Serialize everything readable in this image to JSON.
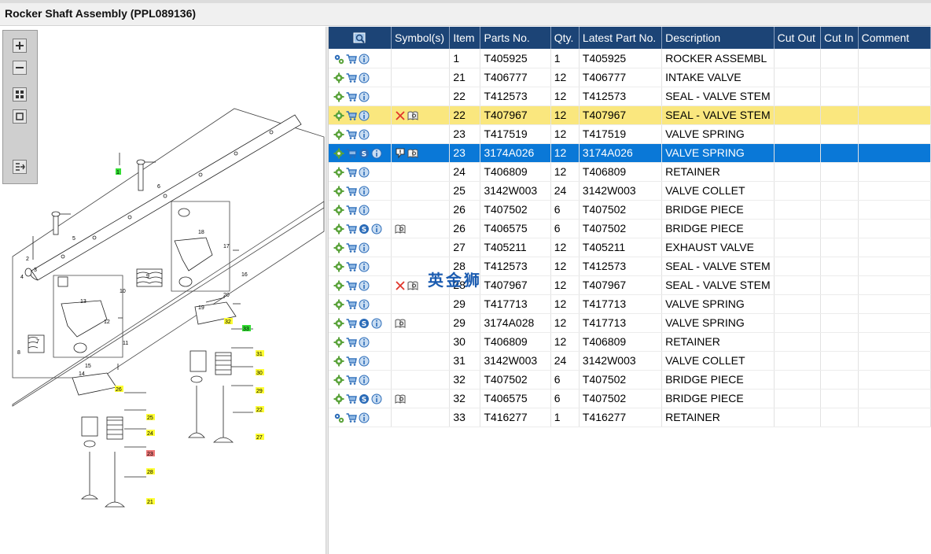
{
  "window": {
    "title": "Rocker Shaft Assembly (PPL089136)"
  },
  "colors": {
    "header_bg": "#1c4476",
    "highlight_yellow": "#fae77e",
    "selected_blue": "#0a78d7",
    "callout_yellow": "#ffff33",
    "callout_green": "#33dd33",
    "callout_red": "#ee7777"
  },
  "toolbar": {
    "buttons": [
      {
        "icon": "zoom-in-icon"
      },
      {
        "icon": "zoom-out-icon"
      },
      {
        "icon": "fit-all-icon"
      },
      {
        "icon": "fit-window-icon"
      },
      {
        "icon": "export-icon"
      }
    ]
  },
  "diagram": {
    "callouts": [
      {
        "label": "1",
        "style": "green"
      },
      {
        "label": "2",
        "style": "plain"
      },
      {
        "label": "3",
        "style": "plain"
      },
      {
        "label": "4",
        "style": "plain"
      },
      {
        "label": "5",
        "style": "plain"
      },
      {
        "label": "6",
        "style": "plain"
      },
      {
        "label": "7",
        "style": "plain"
      },
      {
        "label": "8",
        "style": "plain"
      },
      {
        "label": "9",
        "style": "plain"
      },
      {
        "label": "10",
        "style": "plain"
      },
      {
        "label": "11",
        "style": "plain"
      },
      {
        "label": "12",
        "style": "plain"
      },
      {
        "label": "13",
        "style": "plain"
      },
      {
        "label": "14",
        "style": "plain"
      },
      {
        "label": "15",
        "style": "plain"
      },
      {
        "label": "16",
        "style": "plain"
      },
      {
        "label": "17",
        "style": "plain"
      },
      {
        "label": "18",
        "style": "plain"
      },
      {
        "label": "19",
        "style": "plain"
      },
      {
        "label": "20",
        "style": "plain"
      },
      {
        "label": "21",
        "style": "yellow"
      },
      {
        "label": "22",
        "style": "yellow"
      },
      {
        "label": "23",
        "style": "red"
      },
      {
        "label": "24",
        "style": "yellow"
      },
      {
        "label": "25",
        "style": "yellow"
      },
      {
        "label": "26",
        "style": "yellow"
      },
      {
        "label": "27",
        "style": "yellow"
      },
      {
        "label": "28",
        "style": "yellow"
      },
      {
        "label": "29",
        "style": "yellow"
      },
      {
        "label": "30",
        "style": "yellow"
      },
      {
        "label": "31",
        "style": "yellow"
      },
      {
        "label": "32",
        "style": "yellow"
      },
      {
        "label": "33",
        "style": "green"
      }
    ]
  },
  "table": {
    "columns": [
      "",
      "Symbol(s)",
      "Item",
      "Parts No.",
      "Qty.",
      "Latest Part No.",
      "Description",
      "Cut Out",
      "Cut In",
      "Comment"
    ],
    "rows": [
      {
        "actions": [
          "assembly-gear-icon",
          "cart-icon",
          "info-icon"
        ],
        "symbols": [],
        "item": "1",
        "part": "T405925",
        "qty": "1",
        "latest": "T405925",
        "desc": "ROCKER ASSEMBL",
        "cut_out": "",
        "cut_in": "",
        "comment": "",
        "state": ""
      },
      {
        "actions": [
          "gear-icon",
          "cart-icon",
          "info-icon"
        ],
        "symbols": [],
        "item": "21",
        "part": "T406777",
        "qty": "12",
        "latest": "T406777",
        "desc": "INTAKE VALVE",
        "cut_out": "",
        "cut_in": "",
        "comment": "",
        "state": ""
      },
      {
        "actions": [
          "gear-icon",
          "cart-icon",
          "info-icon"
        ],
        "symbols": [],
        "item": "22",
        "part": "T412573",
        "qty": "12",
        "latest": "T412573",
        "desc": "SEAL - VALVE STEM",
        "cut_out": "",
        "cut_in": "",
        "comment": "",
        "state": ""
      },
      {
        "actions": [
          "gear-icon",
          "cart-icon",
          "info-icon"
        ],
        "symbols": [
          "cross-icon",
          "book-icon"
        ],
        "item": "22",
        "part": "T407967",
        "qty": "12",
        "latest": "T407967",
        "desc": "SEAL - VALVE STEM",
        "cut_out": "",
        "cut_in": "",
        "comment": "",
        "state": "yellow"
      },
      {
        "actions": [
          "gear-icon",
          "cart-icon",
          "info-icon"
        ],
        "symbols": [],
        "item": "23",
        "part": "T417519",
        "qty": "12",
        "latest": "T417519",
        "desc": "VALVE SPRING",
        "cut_out": "",
        "cut_in": "",
        "comment": "",
        "state": ""
      },
      {
        "actions": [
          "gear-icon",
          "cart-icon",
          "s-icon",
          "info-icon"
        ],
        "symbols": [
          "alert-icon",
          "book-icon"
        ],
        "item": "23",
        "part": "3174A026",
        "qty": "12",
        "latest": "3174A026",
        "desc": "VALVE SPRING",
        "cut_out": "",
        "cut_in": "",
        "comment": "",
        "state": "blue"
      },
      {
        "actions": [
          "gear-icon",
          "cart-icon",
          "info-icon"
        ],
        "symbols": [],
        "item": "24",
        "part": "T406809",
        "qty": "12",
        "latest": "T406809",
        "desc": "RETAINER",
        "cut_out": "",
        "cut_in": "",
        "comment": "",
        "state": ""
      },
      {
        "actions": [
          "gear-icon",
          "cart-icon",
          "info-icon"
        ],
        "symbols": [],
        "item": "25",
        "part": "3142W003",
        "qty": "24",
        "latest": "3142W003",
        "desc": "VALVE COLLET",
        "cut_out": "",
        "cut_in": "",
        "comment": "",
        "state": ""
      },
      {
        "actions": [
          "gear-icon",
          "cart-icon",
          "info-icon"
        ],
        "symbols": [],
        "item": "26",
        "part": "T407502",
        "qty": "6",
        "latest": "T407502",
        "desc": "BRIDGE PIECE",
        "cut_out": "",
        "cut_in": "",
        "comment": "",
        "state": ""
      },
      {
        "actions": [
          "gear-icon",
          "cart-icon",
          "s-icon",
          "info-icon"
        ],
        "symbols": [
          "book-icon"
        ],
        "item": "26",
        "part": "T406575",
        "qty": "6",
        "latest": "T407502",
        "desc": "BRIDGE PIECE",
        "cut_out": "",
        "cut_in": "",
        "comment": "",
        "state": ""
      },
      {
        "actions": [
          "gear-icon",
          "cart-icon",
          "info-icon"
        ],
        "symbols": [],
        "item": "27",
        "part": "T405211",
        "qty": "12",
        "latest": "T405211",
        "desc": "EXHAUST VALVE",
        "cut_out": "",
        "cut_in": "",
        "comment": "",
        "state": ""
      },
      {
        "actions": [
          "gear-icon",
          "cart-icon",
          "info-icon"
        ],
        "symbols": [],
        "item": "28",
        "part": "T412573",
        "qty": "12",
        "latest": "T412573",
        "desc": "SEAL - VALVE STEM",
        "cut_out": "",
        "cut_in": "",
        "comment": "",
        "state": ""
      },
      {
        "actions": [
          "gear-icon",
          "cart-icon",
          "info-icon"
        ],
        "symbols": [
          "cross-icon",
          "book-icon"
        ],
        "item": "28",
        "part": "T407967",
        "qty": "12",
        "latest": "T407967",
        "desc": "SEAL - VALVE STEM",
        "cut_out": "",
        "cut_in": "",
        "comment": "",
        "state": ""
      },
      {
        "actions": [
          "gear-icon",
          "cart-icon",
          "info-icon"
        ],
        "symbols": [],
        "item": "29",
        "part": "T417713",
        "qty": "12",
        "latest": "T417713",
        "desc": "VALVE SPRING",
        "cut_out": "",
        "cut_in": "",
        "comment": "",
        "state": ""
      },
      {
        "actions": [
          "gear-icon",
          "cart-icon",
          "s-icon",
          "info-icon"
        ],
        "symbols": [
          "book-icon"
        ],
        "item": "29",
        "part": "3174A028",
        "qty": "12",
        "latest": "T417713",
        "desc": "VALVE SPRING",
        "cut_out": "",
        "cut_in": "",
        "comment": "",
        "state": ""
      },
      {
        "actions": [
          "gear-icon",
          "cart-icon",
          "info-icon"
        ],
        "symbols": [],
        "item": "30",
        "part": "T406809",
        "qty": "12",
        "latest": "T406809",
        "desc": "RETAINER",
        "cut_out": "",
        "cut_in": "",
        "comment": "",
        "state": ""
      },
      {
        "actions": [
          "gear-icon",
          "cart-icon",
          "info-icon"
        ],
        "symbols": [],
        "item": "31",
        "part": "3142W003",
        "qty": "24",
        "latest": "3142W003",
        "desc": "VALVE COLLET",
        "cut_out": "",
        "cut_in": "",
        "comment": "",
        "state": ""
      },
      {
        "actions": [
          "gear-icon",
          "cart-icon",
          "info-icon"
        ],
        "symbols": [],
        "item": "32",
        "part": "T407502",
        "qty": "6",
        "latest": "T407502",
        "desc": "BRIDGE PIECE",
        "cut_out": "",
        "cut_in": "",
        "comment": "",
        "state": ""
      },
      {
        "actions": [
          "gear-icon",
          "cart-icon",
          "s-icon",
          "info-icon"
        ],
        "symbols": [
          "book-icon"
        ],
        "item": "32",
        "part": "T406575",
        "qty": "6",
        "latest": "T407502",
        "desc": "BRIDGE PIECE",
        "cut_out": "",
        "cut_in": "",
        "comment": "",
        "state": ""
      },
      {
        "actions": [
          "assembly-gear-icon",
          "cart-icon",
          "info-icon"
        ],
        "symbols": [],
        "item": "33",
        "part": "T416277",
        "qty": "1",
        "latest": "T416277",
        "desc": "RETAINER",
        "cut_out": "",
        "cut_in": "",
        "comment": "",
        "state": ""
      }
    ]
  },
  "watermark": {
    "text": "英金狮"
  }
}
